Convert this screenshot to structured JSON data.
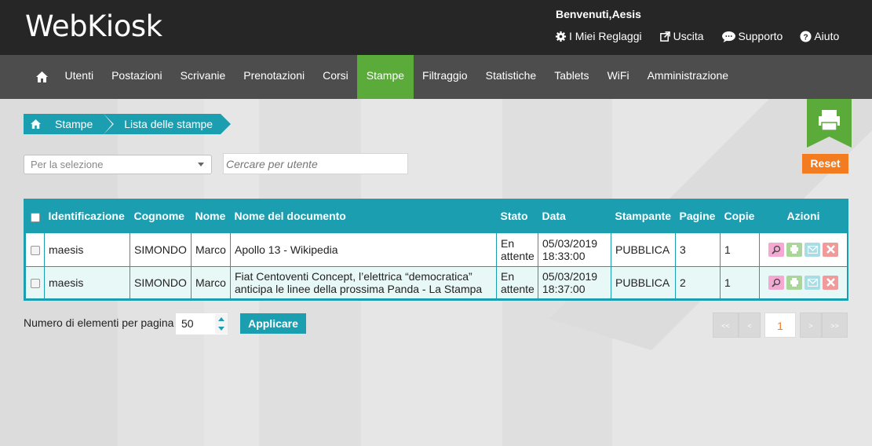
{
  "header": {
    "logo": "WebKiosk",
    "welcome": "Benvenuti,Aesis",
    "links": [
      {
        "label": "I Miei Reglaggi",
        "icon": "gear-icon"
      },
      {
        "label": "Uscita",
        "icon": "external-link-icon"
      },
      {
        "label": "Supporto",
        "icon": "chat-icon"
      },
      {
        "label": "Aiuto",
        "icon": "help-icon"
      }
    ]
  },
  "nav": {
    "items": [
      "Utenti",
      "Postazioni",
      "Scrivanie",
      "Prenotazioni",
      "Corsi",
      "Stampe",
      "Filtraggio",
      "Statistiche",
      "Tablets",
      "WiFi",
      "Amministrazione"
    ],
    "active": "Stampe",
    "active_color": "#5aab3a"
  },
  "breadcrumb": {
    "section": "Stampe",
    "page": "Lista delle stampe"
  },
  "filters": {
    "select_value": "Per la selezione",
    "search_placeholder": "Cercare per utente",
    "reset_label": "Reset"
  },
  "table": {
    "headers": [
      "Identificazione",
      "Cognome",
      "Nome",
      "Nome del documento",
      "Stato",
      "Data",
      "Stampante",
      "Pagine",
      "Copie",
      "Azioni"
    ],
    "rows": [
      {
        "id": "maesis",
        "cognome": "SIMONDO",
        "nome": "Marco",
        "documento": "Apollo 13 - Wikipedia",
        "stato": "En attente",
        "data": "05/03/2019",
        "ora": "18:33:00",
        "stampante": "PUBBLICA",
        "pagine": "3",
        "copie": "1"
      },
      {
        "id": "maesis",
        "cognome": "SIMONDO",
        "nome": "Marco",
        "documento": "Fiat Centoventi Concept, l’elettrica “democratica” anticipa le linee della prossima Panda - La Stampa",
        "stato": "En attente",
        "data": "05/03/2019",
        "ora": "18:37:00",
        "stampante": "PUBBLICA",
        "pagine": "2",
        "copie": "1"
      }
    ]
  },
  "footer": {
    "perpage_label": "Numero di elementi per pagina",
    "perpage_value": "50",
    "apply_label": "Applicare",
    "pager": {
      "first": "<<",
      "prev": "<",
      "current": "1",
      "next": ">",
      "last": ">>"
    }
  },
  "colors": {
    "accent": "#1b9eb0",
    "active_nav": "#5aab3a",
    "reset": "#f47c20"
  }
}
